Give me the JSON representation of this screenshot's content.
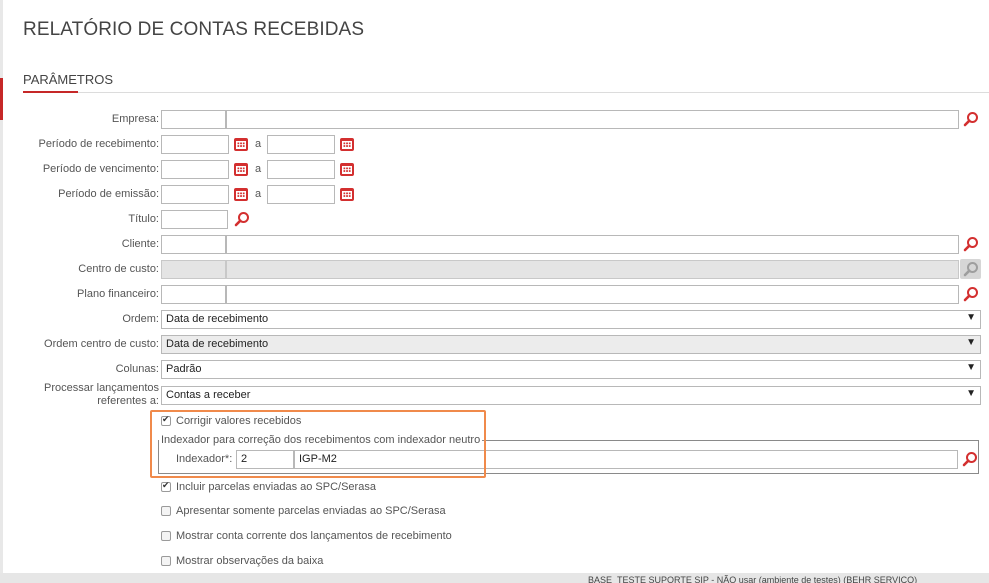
{
  "page": {
    "title": "RELATÓRIO DE CONTAS RECEBIDAS",
    "section_title": "PARÂMETROS"
  },
  "labels": {
    "empresa": "Empresa:",
    "periodo_recebimento": "Período de recebimento:",
    "periodo_vencimento": "Período de vencimento:",
    "periodo_emissao": "Período de emissão:",
    "titulo": "Título:",
    "cliente": "Cliente:",
    "centro_custo": "Centro de custo:",
    "plano_financeiro": "Plano financeiro:",
    "ordem": "Ordem:",
    "ordem_centro_custo": "Ordem centro de custo:",
    "colunas": "Colunas:",
    "processar_l1": "Processar lançamentos",
    "processar_l2": "referentes a:",
    "range_sep": "a"
  },
  "fields": {
    "empresa_code": "",
    "empresa_name": "",
    "receb_from": "",
    "receb_to": "",
    "venc_from": "",
    "venc_to": "",
    "emissao_from": "",
    "emissao_to": "",
    "titulo": "",
    "cliente_code": "",
    "cliente_name": "",
    "centro_code": "",
    "centro_name": "",
    "plano_code": "",
    "plano_name": ""
  },
  "selects": {
    "ordem": "Data de recebimento",
    "ordem_centro": "Data de recebimento",
    "colunas": "Padrão",
    "processar": "Contas a receber"
  },
  "checkboxes": {
    "corrigir": {
      "label": "Corrigir valores recebidos",
      "checked": true
    },
    "incluir_spc": {
      "label": "Incluir parcelas enviadas ao SPC/Serasa",
      "checked": true
    },
    "somente_spc": {
      "label": "Apresentar somente parcelas enviadas ao SPC/Serasa",
      "checked": false
    },
    "conta_corrente": {
      "label": "Mostrar conta corrente dos lançamentos de recebimento",
      "checked": false
    },
    "observacoes": {
      "label": "Mostrar observações da baixa",
      "checked": false
    }
  },
  "indexador": {
    "legend": "Indexador para correção dos recebimentos com indexador neutro",
    "label": "Indexador*:",
    "code": "2",
    "name": "IGP-M2"
  },
  "footer": {
    "text": "BASE_TESTE SUPORTE SIP - NÃO usar (ambiente de testes) (BEHR SERVIÇO)"
  },
  "colors": {
    "accent": "#c62828",
    "highlight": "#f08a4b"
  },
  "icons": {
    "calendar": "calendar-icon",
    "search": "magnifier-icon",
    "dropdown": "caret-down-icon"
  }
}
